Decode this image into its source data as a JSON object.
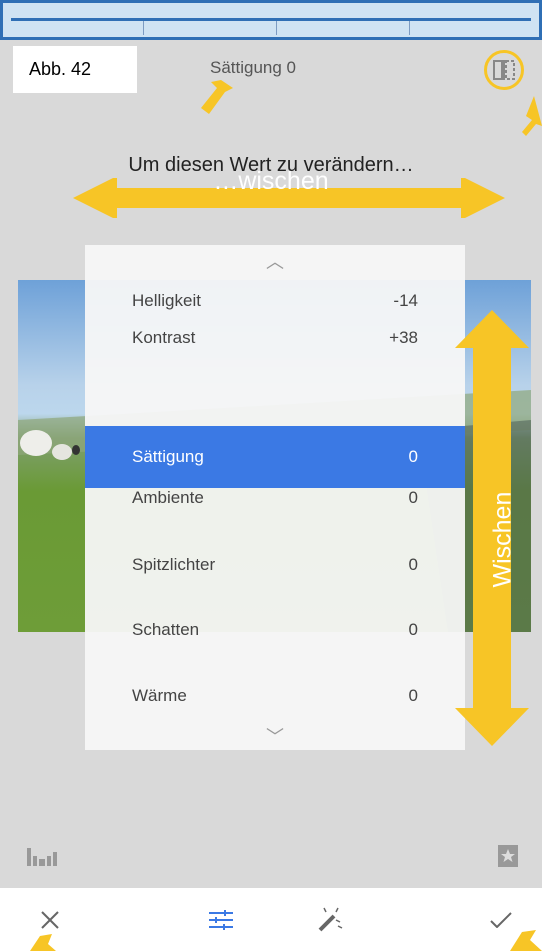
{
  "figure_label": "Abb. 42",
  "header": {
    "title": "Sättigung 0"
  },
  "annotations": {
    "hint": "Um diesen Wert zu verändern…",
    "horizontal_label": "…wischen",
    "vertical_label": "Wischen"
  },
  "adjustments": [
    {
      "label": "Helligkeit",
      "value": "-14"
    },
    {
      "label": "Kontrast",
      "value": "+38"
    },
    {
      "label": "Sättigung",
      "value": "0",
      "selected": true
    },
    {
      "label": "Ambiente",
      "value": "0"
    },
    {
      "label": "Spitzlichter",
      "value": "0"
    },
    {
      "label": "Schatten",
      "value": "0"
    },
    {
      "label": "Wärme",
      "value": "0"
    }
  ],
  "icons": {
    "compare": "compare-icon",
    "histogram": "histogram-icon",
    "bookmark": "bookmark-icon",
    "cancel": "close-icon",
    "tune": "tune-icon",
    "auto": "magic-wand-icon",
    "apply": "checkmark-icon"
  },
  "colors": {
    "accent": "#3b79e4",
    "annotation": "#f7c526"
  }
}
